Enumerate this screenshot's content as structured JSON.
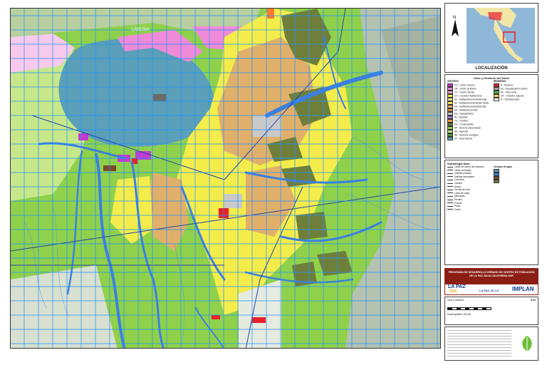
{
  "map": {
    "lake_label": "LAGUNA",
    "grid_color": "#1e90ff",
    "colors": {
      "base_green": "#8fd14a",
      "water": "#5b9fb8",
      "river": "#3d7fe0",
      "yellow": "#f3ec4b",
      "pink": "#f08ad8",
      "magenta": "#c53ad0",
      "tan": "#e0b06a",
      "grey": "#c9c9c9",
      "olive": "#6f7f3a",
      "red": "#e8202a",
      "relief": "#b5c2b0"
    }
  },
  "legend": {
    "localization_title": "LOCALIZACIÓN",
    "uses_title": "Usos y Destinos del Suelo",
    "col1_header": "CENTROS",
    "col2_header": "RESERVAS",
    "base_symbology_title": "Simbología base",
    "water_bodies_label": "Cuerpos de agua",
    "items_col1": [
      {
        "label": "CU - Centro Urbano",
        "color": "#c53ad0"
      },
      {
        "label": "CB - Centro de Barrio",
        "color": "#f08ad8"
      },
      {
        "label": "CV - Centro Vecinal",
        "color": "#f3a0c8"
      },
      {
        "label": "CH - Corredor Habitacional",
        "color": "#f3ec4b"
      },
      {
        "label": "H1 - Habitacional densidad baja",
        "color": "#fff8a0"
      },
      {
        "label": "H2 - Habitacional densidad media",
        "color": "#f3ec4b"
      },
      {
        "label": "H3 - Habitacional densidad alta",
        "color": "#e0b06a"
      },
      {
        "label": "H4 - Habitacional mixto",
        "color": "#d89040"
      },
      {
        "label": "EQ - Equipamiento",
        "color": "#c9c9c9"
      },
      {
        "label": "IN - Industria",
        "color": "#9b7bd0"
      },
      {
        "label": "TU - Turístico",
        "color": "#ff9e3d"
      },
      {
        "label": "CO - Conservación",
        "color": "#6f7f3a"
      },
      {
        "label": "AP - Área de preservación",
        "color": "#8fd14a"
      },
      {
        "label": "AG - Agrícola",
        "color": "#c6e88a"
      },
      {
        "label": "RE - Reserva ecológica",
        "color": "#4f9a3a"
      },
      {
        "label": "ZF - Zona federal",
        "color": "#5b9fb8"
      }
    ],
    "items_col2": [
      {
        "label": "R - Reserva",
        "color": "#e8202a"
      },
      {
        "label": "EU - Equipamiento urbano",
        "color": "#a9a9a9"
      },
      {
        "label": "AV - Área verde",
        "color": "#4fb84a"
      },
      {
        "label": "CR - Corredor regional",
        "color": "#ffd15a"
      },
      {
        "label": "IF - Infraestructura",
        "color": "#ffffff"
      }
    ],
    "base_items": [
      "Límite de centro de población",
      "Límite municipal",
      "Vialidad primaria",
      "Vialidad secundaria",
      "Carretera",
      "Camino",
      "Arroyo",
      "Curvas de nivel",
      "Línea de costa",
      "Manzanas",
      "Predios",
      "Puente",
      "Presa",
      "Canal"
    ]
  },
  "title_block": {
    "program_title": "PROGRAMA DE DESARROLLO URBANO DE CENTRO DE POBLACIÓN DE LA PAZ, BAJA CALIFORNIA SUR",
    "brand_left": "LA PAZ",
    "brand_left_sub": "QUE",
    "brand_right": "IMPLAN",
    "brand_municipio": "LA PAZ, B.C.S.",
    "map_name": "Usos y Destinos",
    "map_number": "E-02",
    "footer_notes": "Escala gráfica 1:50,000"
  }
}
